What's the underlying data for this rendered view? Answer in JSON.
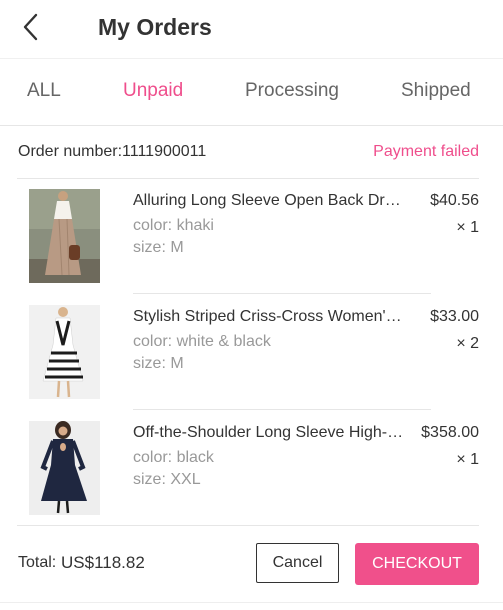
{
  "header": {
    "title": "My Orders",
    "back_icon": "chevron-left-icon"
  },
  "tabs": [
    {
      "label": "ALL",
      "active": false
    },
    {
      "label": "Unpaid",
      "active": true
    },
    {
      "label": "Processing",
      "active": false
    },
    {
      "label": "Shipped",
      "active": false
    }
  ],
  "order": {
    "number_label": "Order number:1111900011",
    "status": "Payment failed",
    "items": [
      {
        "name": "Alluring Long Sleeve Open Back Dress",
        "color": "color: khaki",
        "size": "size: M",
        "price": "$40.56",
        "qty": "× 1"
      },
      {
        "name": "Stylish Striped Criss-Cross Women's Dress",
        "color": "color: white & black",
        "size": "size: M",
        "price": "$33.00",
        "qty": "× 2"
      },
      {
        "name": "Off-the-Shoulder Long Sleeve High-Low Dress",
        "color": "color: black",
        "size": "size: XXL",
        "price": "$358.00",
        "qty": "× 1"
      }
    ]
  },
  "footer": {
    "total_label": "Total:",
    "total_value": "US$118.82",
    "cancel_label": "Cancel",
    "checkout_label": "CHECKOUT"
  },
  "colors": {
    "accent": "#ef4e8c",
    "checkout_bg": "#f0508b",
    "text": "#333333",
    "muted": "#999999",
    "divider": "#e6e6e6"
  }
}
